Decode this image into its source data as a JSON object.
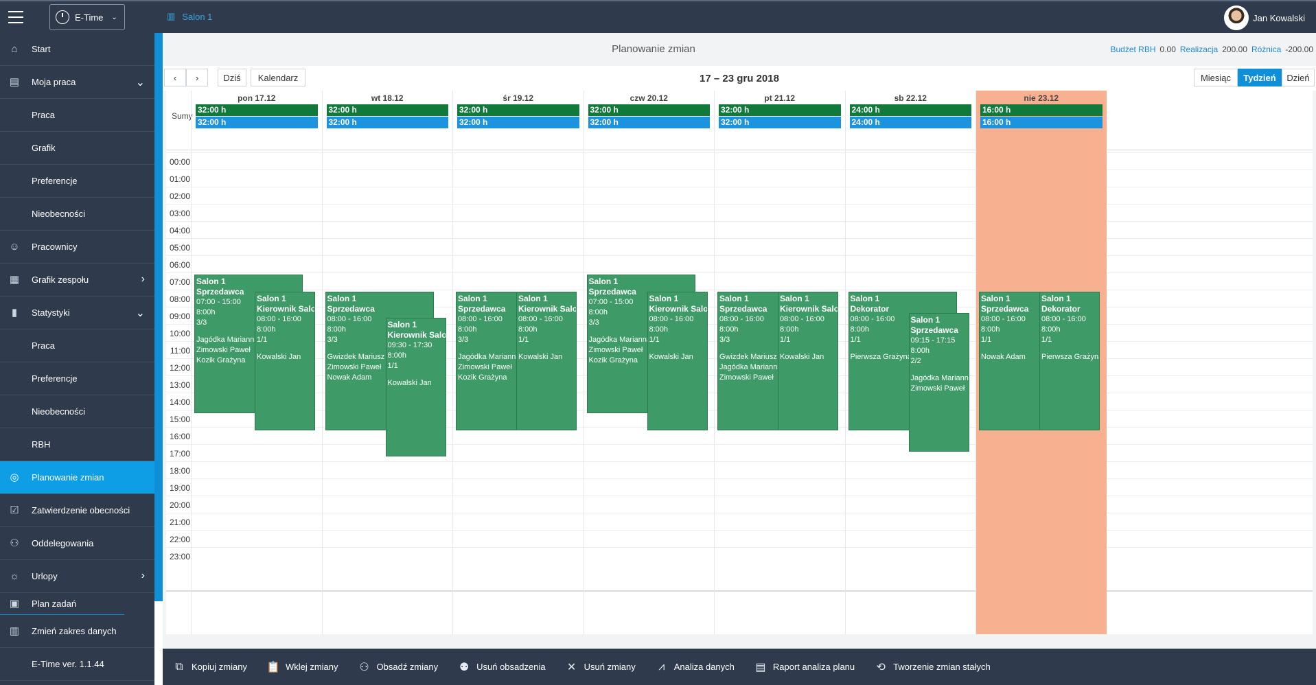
{
  "topbar": {
    "app_name": "E-Time",
    "context": "Salon 1",
    "user_name": "Jan Kowalski"
  },
  "sidebar": {
    "items": [
      {
        "label": "Start",
        "icon": "home-icon",
        "arrow": ""
      },
      {
        "label": "Moja praca",
        "icon": "work-icon",
        "arrow": "⌄"
      },
      {
        "label": "Praca",
        "icon": "",
        "arrow": ""
      },
      {
        "label": "Grafik",
        "icon": "",
        "arrow": ""
      },
      {
        "label": "Preferencje",
        "icon": "",
        "arrow": ""
      },
      {
        "label": "Nieobecności",
        "icon": "",
        "arrow": ""
      },
      {
        "label": "Pracownicy",
        "icon": "people-icon",
        "arrow": ""
      },
      {
        "label": "Grafik zespołu",
        "icon": "team-calendar-icon",
        "arrow": "›"
      },
      {
        "label": "Statystyki",
        "icon": "chart-icon",
        "arrow": "⌄"
      },
      {
        "label": "Praca",
        "icon": "",
        "arrow": ""
      },
      {
        "label": "Preferencje",
        "icon": "",
        "arrow": ""
      },
      {
        "label": "Nieobecności",
        "icon": "",
        "arrow": ""
      },
      {
        "label": "RBH",
        "icon": "",
        "arrow": ""
      },
      {
        "label": "Planowanie zmian",
        "icon": "planning-icon",
        "arrow": "",
        "active": true
      },
      {
        "label": "Zatwierdzenie obecności",
        "icon": "approve-icon",
        "arrow": ""
      },
      {
        "label": "Oddelegowania",
        "icon": "delegate-icon",
        "arrow": ""
      },
      {
        "label": "Urlopy",
        "icon": "vacation-icon",
        "arrow": "›"
      },
      {
        "label": "Plan zadań",
        "icon": "task-icon",
        "arrow": ""
      },
      {
        "label": "Zmień zakres danych",
        "icon": "building-icon",
        "arrow": ""
      },
      {
        "label": "E-Time ver. 1.1.44",
        "icon": "",
        "arrow": ""
      }
    ]
  },
  "main": {
    "title": "Planowanie zmian",
    "budget": {
      "budget_label": "Budżet RBH",
      "budget_value": "0.00",
      "real_label": "Realizacja",
      "real_value": "200.00",
      "diff_label": "Różnica",
      "diff_value": "-200.00"
    },
    "toolbar": {
      "prev": "‹",
      "next": "›",
      "today": "Dziś",
      "calendar": "Kalendarz",
      "range": "17 – 23 gru 2018",
      "views": [
        "Miesiąc",
        "Tydzień",
        "Dzień"
      ],
      "active_view": "Tydzień"
    },
    "sumy_label": "Sumy",
    "days": [
      {
        "label": "pon 17.12",
        "sum1": "32:00 h",
        "sum2": "32:00 h"
      },
      {
        "label": "wt 18.12",
        "sum1": "32:00 h",
        "sum2": "32:00 h"
      },
      {
        "label": "śr 19.12",
        "sum1": "32:00 h",
        "sum2": "32:00 h"
      },
      {
        "label": "czw 20.12",
        "sum1": "32:00 h",
        "sum2": "32:00 h"
      },
      {
        "label": "pt 21.12",
        "sum1": "32:00 h",
        "sum2": "32:00 h"
      },
      {
        "label": "sb 22.12",
        "sum1": "24:00 h",
        "sum2": "24:00 h"
      },
      {
        "label": "nie 23.12",
        "sum1": "16:00 h",
        "sum2": "16:00 h"
      }
    ],
    "hours": [
      "00:00",
      "01:00",
      "02:00",
      "03:00",
      "04:00",
      "05:00",
      "06:00",
      "07:00",
      "08:00",
      "09:00",
      "10:00",
      "11:00",
      "12:00",
      "13:00",
      "14:00",
      "15:00",
      "16:00",
      "17:00",
      "18:00",
      "19:00",
      "20:00",
      "21:00",
      "22:00",
      "23:00"
    ],
    "shifts": [
      {
        "day": 0,
        "slot": 0,
        "start": 7,
        "end": 15,
        "lines": [
          "Salon 1",
          "Sprzedawca",
          "07:00 - 15:00",
          "8:00h",
          "3/3",
          "",
          "Jagódka Marianna",
          "Zimowski Paweł",
          "Kozik Grażyna"
        ]
      },
      {
        "day": 0,
        "slot": 1,
        "start": 8,
        "end": 16,
        "lines": [
          "Salon 1",
          "Kierownik Salonu",
          "08:00 - 16:00",
          "8:00h",
          "1/1",
          "",
          "Kowalski Jan"
        ]
      },
      {
        "day": 1,
        "slot": 0,
        "start": 8,
        "end": 16,
        "lines": [
          "Salon 1",
          "Sprzedawca",
          "08:00 - 16:00",
          "8:00h",
          "3/3",
          "",
          "Gwizdek Mariusz",
          "Zimowski Paweł",
          "Nowak Adam"
        ]
      },
      {
        "day": 1,
        "slot": 1,
        "start": 9.5,
        "end": 17.5,
        "lines": [
          "Salon 1",
          "Kierownik Salonu",
          "09:30 - 17:30",
          "8:00h",
          "1/1",
          "",
          "Kowalski Jan"
        ]
      },
      {
        "day": 2,
        "slot": 0,
        "start": 8,
        "end": 16,
        "lines": [
          "Salon 1",
          "Sprzedawca",
          "08:00 - 16:00",
          "8:00h",
          "3/3",
          "",
          "Jagódka Marianna",
          "Zimowski Paweł",
          "Kozik Grażyna"
        ]
      },
      {
        "day": 2,
        "slot": 1,
        "start": 8,
        "end": 16,
        "lines": [
          "Salon 1",
          "Kierownik Salonu",
          "08:00 - 16:00",
          "8:00h",
          "1/1",
          "",
          "Kowalski Jan"
        ]
      },
      {
        "day": 3,
        "slot": 0,
        "start": 7,
        "end": 15,
        "lines": [
          "Salon 1",
          "Sprzedawca",
          "07:00 - 15:00",
          "8:00h",
          "3/3",
          "",
          "Jagódka Marianna",
          "Zimowski Paweł",
          "Kozik Grażyna"
        ]
      },
      {
        "day": 3,
        "slot": 1,
        "start": 8,
        "end": 16,
        "lines": [
          "Salon 1",
          "Kierownik Salonu",
          "08:00 - 16:00",
          "8:00h",
          "1/1",
          "",
          "Kowalski Jan"
        ]
      },
      {
        "day": 4,
        "slot": 0,
        "start": 8,
        "end": 16,
        "lines": [
          "Salon 1",
          "Sprzedawca",
          "08:00 - 16:00",
          "8:00h",
          "3/3",
          "",
          "Gwizdek Mariusz",
          "Jagódka Marianna",
          "Zimowski Paweł"
        ]
      },
      {
        "day": 4,
        "slot": 1,
        "start": 8,
        "end": 16,
        "lines": [
          "Salon 1",
          "Kierownik Salonu",
          "08:00 - 16:00",
          "8:00h",
          "1/1",
          "",
          "Kowalski Jan"
        ]
      },
      {
        "day": 5,
        "slot": 0,
        "start": 8,
        "end": 16,
        "lines": [
          "Salon 1",
          "Dekorator",
          "08:00 - 16:00",
          "8:00h",
          "1/1",
          "",
          "Pierwsza Grażyna"
        ]
      },
      {
        "day": 5,
        "slot": 1,
        "start": 9.25,
        "end": 17.25,
        "lines": [
          "Salon 1",
          "Sprzedawca",
          "09:15 - 17:15",
          "8:00h",
          "2/2",
          "",
          "Jagódka Marianna",
          "Zimowski Paweł"
        ]
      },
      {
        "day": 6,
        "slot": 0,
        "start": 8,
        "end": 16,
        "lines": [
          "Salon 1",
          "Sprzedawca",
          "08:00 - 16:00",
          "8:00h",
          "1/1",
          "",
          "Nowak Adam"
        ]
      },
      {
        "day": 6,
        "slot": 1,
        "start": 8,
        "end": 16,
        "lines": [
          "Salon 1",
          "Dekorator",
          "08:00 - 16:00",
          "8:00h",
          "1/1",
          "",
          "Pierwsza Grażyna"
        ]
      }
    ]
  },
  "actions": [
    {
      "label": "Kopiuj zmiany",
      "icon": "copy-icon"
    },
    {
      "label": "Wklej zmiany",
      "icon": "paste-icon"
    },
    {
      "label": "Obsadź zmiany",
      "icon": "assign-people-icon"
    },
    {
      "label": "Usuń obsadzenia",
      "icon": "remove-assignment-icon"
    },
    {
      "label": "Usuń zmiany",
      "icon": "delete-icon"
    },
    {
      "label": "Analiza danych",
      "icon": "analysis-icon"
    },
    {
      "label": "Raport analiza planu",
      "icon": "report-icon"
    },
    {
      "label": "Tworzenie zmian stałych",
      "icon": "recurring-shift-icon"
    }
  ],
  "colors": {
    "sidebar_bg": "#2f3b4c",
    "accent": "#0e9ee6",
    "shift_green": "#3e9a66",
    "sum_green": "#0f7a3a",
    "sum_blue": "#1c93de",
    "sunday_bg": "#f8b190"
  }
}
